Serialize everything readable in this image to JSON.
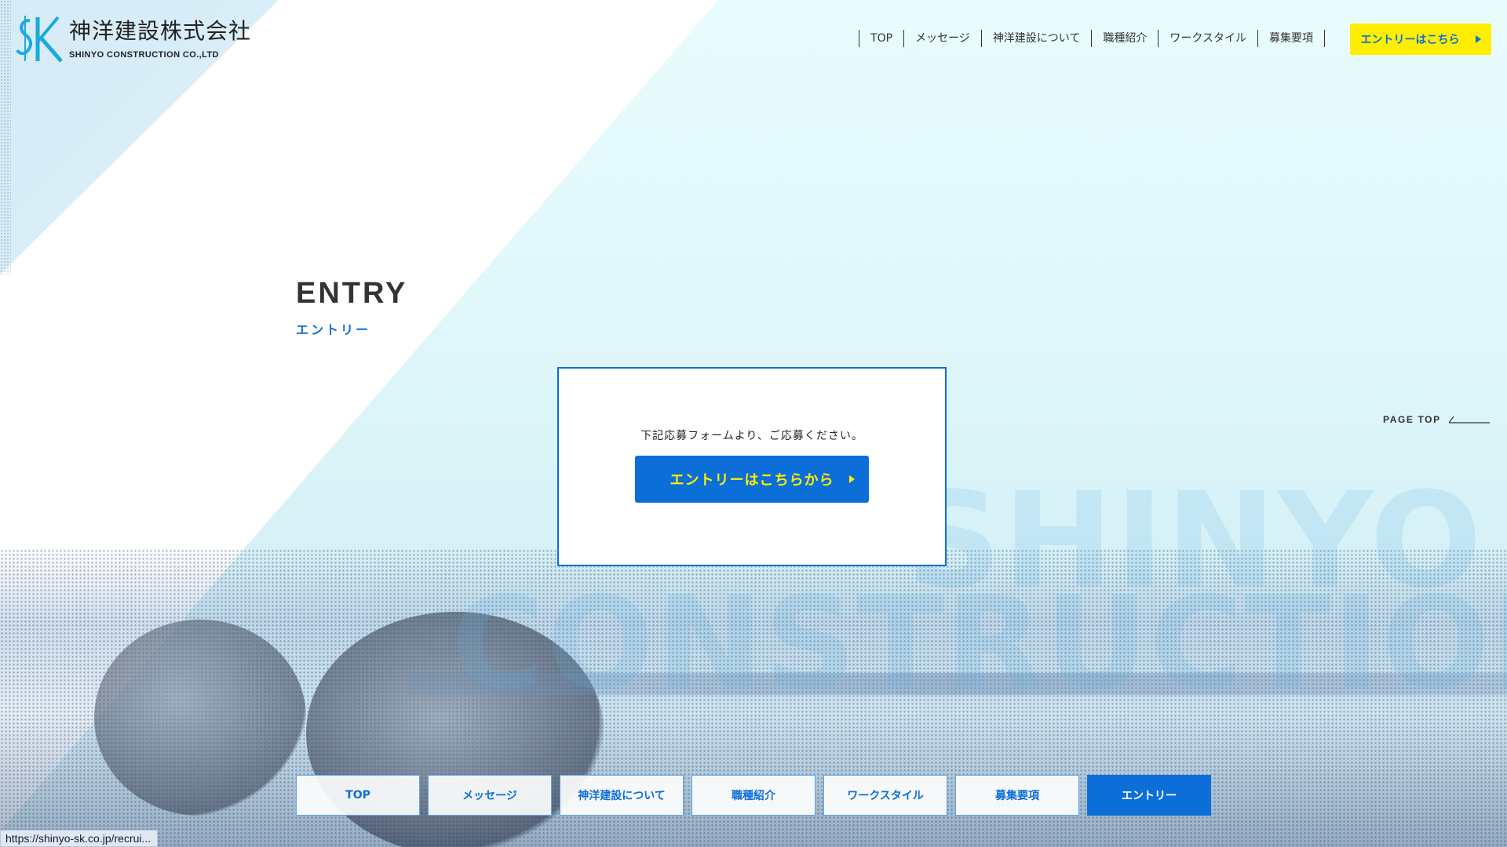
{
  "logo": {
    "jp": "神洋建設株式会社",
    "en": "SHINYO CONSTRUCTION CO.,LTD",
    "color": "#1aa9e0"
  },
  "nav": {
    "items": [
      "TOP",
      "メッセージ",
      "神洋建設について",
      "職種紹介",
      "ワークスタイル",
      "募集要項"
    ],
    "entry_button": "エントリーはこちら"
  },
  "heading": {
    "en": "ENTRY",
    "jp": "エントリー"
  },
  "card": {
    "text": "下記応募フォームより、ご応募ください。",
    "button": "エントリーはこちらから"
  },
  "page_top": "PAGE TOP",
  "watermark": {
    "line1": "SHINYO",
    "line2": "CONSTRUCTION"
  },
  "footer_nav": {
    "items": [
      "TOP",
      "メッセージ",
      "神洋建設について",
      "職種紹介",
      "ワークスタイル",
      "募集要項",
      "エントリー"
    ],
    "active": "エントリー"
  },
  "status_bar": {
    "url": "https://shinyo-sk.co.jp/recrui..."
  },
  "colors": {
    "accent_blue": "#0c6ed8",
    "accent_yellow": "#ffee00"
  }
}
